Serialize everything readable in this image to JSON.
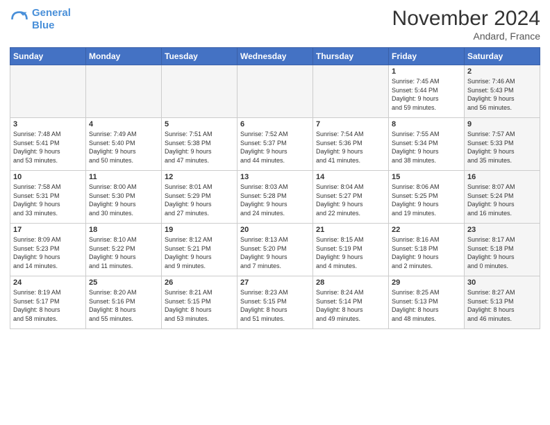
{
  "logo": {
    "line1": "General",
    "line2": "Blue"
  },
  "title": "November 2024",
  "location": "Andard, France",
  "days_of_week": [
    "Sunday",
    "Monday",
    "Tuesday",
    "Wednesday",
    "Thursday",
    "Friday",
    "Saturday"
  ],
  "weeks": [
    [
      {
        "num": "",
        "detail": "",
        "empty": true
      },
      {
        "num": "",
        "detail": "",
        "empty": true
      },
      {
        "num": "",
        "detail": "",
        "empty": true
      },
      {
        "num": "",
        "detail": "",
        "empty": true
      },
      {
        "num": "",
        "detail": "",
        "empty": true
      },
      {
        "num": "1",
        "detail": "Sunrise: 7:45 AM\nSunset: 5:44 PM\nDaylight: 9 hours\nand 59 minutes.",
        "empty": false
      },
      {
        "num": "2",
        "detail": "Sunrise: 7:46 AM\nSunset: 5:43 PM\nDaylight: 9 hours\nand 56 minutes.",
        "empty": false,
        "shaded": true
      }
    ],
    [
      {
        "num": "3",
        "detail": "Sunrise: 7:48 AM\nSunset: 5:41 PM\nDaylight: 9 hours\nand 53 minutes.",
        "empty": false
      },
      {
        "num": "4",
        "detail": "Sunrise: 7:49 AM\nSunset: 5:40 PM\nDaylight: 9 hours\nand 50 minutes.",
        "empty": false
      },
      {
        "num": "5",
        "detail": "Sunrise: 7:51 AM\nSunset: 5:38 PM\nDaylight: 9 hours\nand 47 minutes.",
        "empty": false
      },
      {
        "num": "6",
        "detail": "Sunrise: 7:52 AM\nSunset: 5:37 PM\nDaylight: 9 hours\nand 44 minutes.",
        "empty": false
      },
      {
        "num": "7",
        "detail": "Sunrise: 7:54 AM\nSunset: 5:36 PM\nDaylight: 9 hours\nand 41 minutes.",
        "empty": false
      },
      {
        "num": "8",
        "detail": "Sunrise: 7:55 AM\nSunset: 5:34 PM\nDaylight: 9 hours\nand 38 minutes.",
        "empty": false
      },
      {
        "num": "9",
        "detail": "Sunrise: 7:57 AM\nSunset: 5:33 PM\nDaylight: 9 hours\nand 35 minutes.",
        "empty": false,
        "shaded": true
      }
    ],
    [
      {
        "num": "10",
        "detail": "Sunrise: 7:58 AM\nSunset: 5:31 PM\nDaylight: 9 hours\nand 33 minutes.",
        "empty": false
      },
      {
        "num": "11",
        "detail": "Sunrise: 8:00 AM\nSunset: 5:30 PM\nDaylight: 9 hours\nand 30 minutes.",
        "empty": false
      },
      {
        "num": "12",
        "detail": "Sunrise: 8:01 AM\nSunset: 5:29 PM\nDaylight: 9 hours\nand 27 minutes.",
        "empty": false
      },
      {
        "num": "13",
        "detail": "Sunrise: 8:03 AM\nSunset: 5:28 PM\nDaylight: 9 hours\nand 24 minutes.",
        "empty": false
      },
      {
        "num": "14",
        "detail": "Sunrise: 8:04 AM\nSunset: 5:27 PM\nDaylight: 9 hours\nand 22 minutes.",
        "empty": false
      },
      {
        "num": "15",
        "detail": "Sunrise: 8:06 AM\nSunset: 5:25 PM\nDaylight: 9 hours\nand 19 minutes.",
        "empty": false
      },
      {
        "num": "16",
        "detail": "Sunrise: 8:07 AM\nSunset: 5:24 PM\nDaylight: 9 hours\nand 16 minutes.",
        "empty": false,
        "shaded": true
      }
    ],
    [
      {
        "num": "17",
        "detail": "Sunrise: 8:09 AM\nSunset: 5:23 PM\nDaylight: 9 hours\nand 14 minutes.",
        "empty": false
      },
      {
        "num": "18",
        "detail": "Sunrise: 8:10 AM\nSunset: 5:22 PM\nDaylight: 9 hours\nand 11 minutes.",
        "empty": false
      },
      {
        "num": "19",
        "detail": "Sunrise: 8:12 AM\nSunset: 5:21 PM\nDaylight: 9 hours\nand 9 minutes.",
        "empty": false
      },
      {
        "num": "20",
        "detail": "Sunrise: 8:13 AM\nSunset: 5:20 PM\nDaylight: 9 hours\nand 7 minutes.",
        "empty": false
      },
      {
        "num": "21",
        "detail": "Sunrise: 8:15 AM\nSunset: 5:19 PM\nDaylight: 9 hours\nand 4 minutes.",
        "empty": false
      },
      {
        "num": "22",
        "detail": "Sunrise: 8:16 AM\nSunset: 5:18 PM\nDaylight: 9 hours\nand 2 minutes.",
        "empty": false
      },
      {
        "num": "23",
        "detail": "Sunrise: 8:17 AM\nSunset: 5:18 PM\nDaylight: 9 hours\nand 0 minutes.",
        "empty": false,
        "shaded": true
      }
    ],
    [
      {
        "num": "24",
        "detail": "Sunrise: 8:19 AM\nSunset: 5:17 PM\nDaylight: 8 hours\nand 58 minutes.",
        "empty": false
      },
      {
        "num": "25",
        "detail": "Sunrise: 8:20 AM\nSunset: 5:16 PM\nDaylight: 8 hours\nand 55 minutes.",
        "empty": false
      },
      {
        "num": "26",
        "detail": "Sunrise: 8:21 AM\nSunset: 5:15 PM\nDaylight: 8 hours\nand 53 minutes.",
        "empty": false
      },
      {
        "num": "27",
        "detail": "Sunrise: 8:23 AM\nSunset: 5:15 PM\nDaylight: 8 hours\nand 51 minutes.",
        "empty": false
      },
      {
        "num": "28",
        "detail": "Sunrise: 8:24 AM\nSunset: 5:14 PM\nDaylight: 8 hours\nand 49 minutes.",
        "empty": false
      },
      {
        "num": "29",
        "detail": "Sunrise: 8:25 AM\nSunset: 5:13 PM\nDaylight: 8 hours\nand 48 minutes.",
        "empty": false
      },
      {
        "num": "30",
        "detail": "Sunrise: 8:27 AM\nSunset: 5:13 PM\nDaylight: 8 hours\nand 46 minutes.",
        "empty": false,
        "shaded": true
      }
    ]
  ]
}
